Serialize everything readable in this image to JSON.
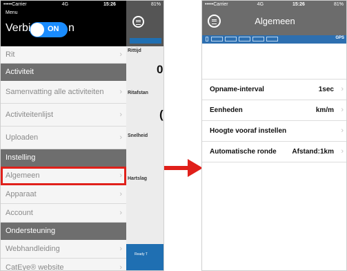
{
  "left_phone": {
    "statusbar": {
      "carrier": "•••••Carrier",
      "network": "4G",
      "time": "15:26",
      "battery": "81%"
    },
    "menu_title": "Menu",
    "verbinding_label": "Verbinding",
    "toggle_text": "ON",
    "toggle_tail": "n",
    "menu_items": [
      {
        "label": "Rit",
        "kind": "item"
      },
      {
        "label": "Activiteit",
        "kind": "header"
      },
      {
        "label": "Samenvatting alle activiteiten",
        "kind": "item"
      },
      {
        "label": "Activiteitenlijst",
        "kind": "item"
      },
      {
        "label": "Uploaden",
        "kind": "item"
      },
      {
        "label": "Instelling",
        "kind": "header"
      },
      {
        "label": "Algemeen",
        "kind": "item",
        "selected": true
      },
      {
        "label": "Apparaat",
        "kind": "item"
      },
      {
        "label": "Account",
        "kind": "item"
      },
      {
        "label": "Ondersteuning",
        "kind": "header"
      },
      {
        "label": "Webhandleiding",
        "kind": "item"
      },
      {
        "label": "CatEye® website",
        "kind": "item"
      }
    ],
    "dashboard": {
      "labels": [
        "Rittijd",
        "Ritafstan",
        "Snelheid",
        "Hartslag"
      ],
      "values": [
        "0:",
        "("
      ],
      "ready_text": "Ready T"
    }
  },
  "right_phone": {
    "statusbar": {
      "carrier": "•••••Carrier",
      "network": "4G",
      "time": "15:26",
      "battery": "81%"
    },
    "title": "Algemeen",
    "gps_label": "GPS",
    "settings": [
      {
        "label": "Opname-interval",
        "value": "1sec"
      },
      {
        "label": "Eenheden",
        "value": "km/m"
      },
      {
        "label": "Hoogte vooraf instellen",
        "value": ""
      },
      {
        "label": "Automatische ronde",
        "value": "Afstand:1km"
      }
    ]
  },
  "colors": {
    "highlight_red": "#e0201a",
    "toggle_blue": "#1a8cff",
    "sensor_blue": "#2d6fb0",
    "header_gray": "#6c6c6c"
  }
}
